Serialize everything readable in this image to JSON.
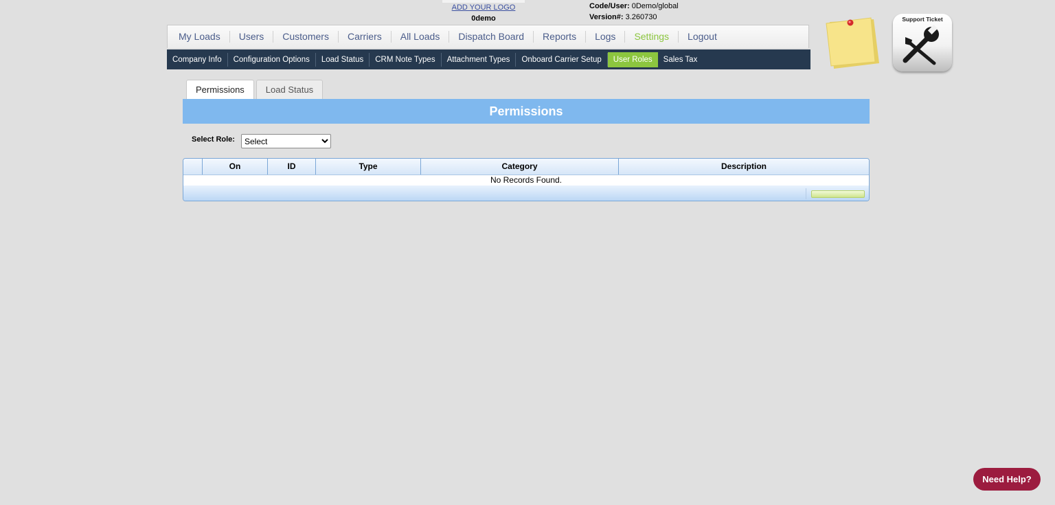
{
  "header": {
    "logo_link": "ADD YOUR LOGO",
    "company": "0demo",
    "code_user_label": "Code/User:",
    "code_user_value": "0Demo/global",
    "version_label": "Version#:",
    "version_value": "3.260730"
  },
  "main_nav": {
    "items": [
      {
        "label": "My Loads"
      },
      {
        "label": "Users"
      },
      {
        "label": "Customers"
      },
      {
        "label": "Carriers"
      },
      {
        "label": "All Loads"
      },
      {
        "label": "Dispatch Board"
      },
      {
        "label": "Reports"
      },
      {
        "label": "Logs"
      },
      {
        "label": "Settings",
        "active": true
      },
      {
        "label": "Logout"
      }
    ]
  },
  "sub_nav": {
    "items": [
      {
        "label": "Company Info"
      },
      {
        "label": "Configuration Options"
      },
      {
        "label": "Load Status"
      },
      {
        "label": "CRM Note Types"
      },
      {
        "label": "Attachment Types"
      },
      {
        "label": "Onboard Carrier Setup"
      },
      {
        "label": "User Roles",
        "active": true
      },
      {
        "label": "Sales Tax"
      }
    ]
  },
  "support": {
    "label": "Support Ticket",
    "icon": "wrench-icon"
  },
  "sticky_note": {
    "icon": "sticky-note-icon"
  },
  "tabs": [
    {
      "label": "Permissions",
      "active": true
    },
    {
      "label": "Load Status",
      "active": false
    }
  ],
  "section": {
    "title": "Permissions"
  },
  "role": {
    "label": "Select Role:",
    "selected": "Select"
  },
  "grid": {
    "columns": [
      "",
      "On",
      "ID",
      "Type",
      "Category",
      "Description"
    ],
    "empty_message": "No Records Found."
  },
  "help": {
    "label": "Need Help?"
  },
  "colors": {
    "accent_green": "#8cc63f",
    "subnav_bg": "#26394f",
    "section_blue": "#7fb8ee",
    "help_red": "#9c1c3f"
  }
}
